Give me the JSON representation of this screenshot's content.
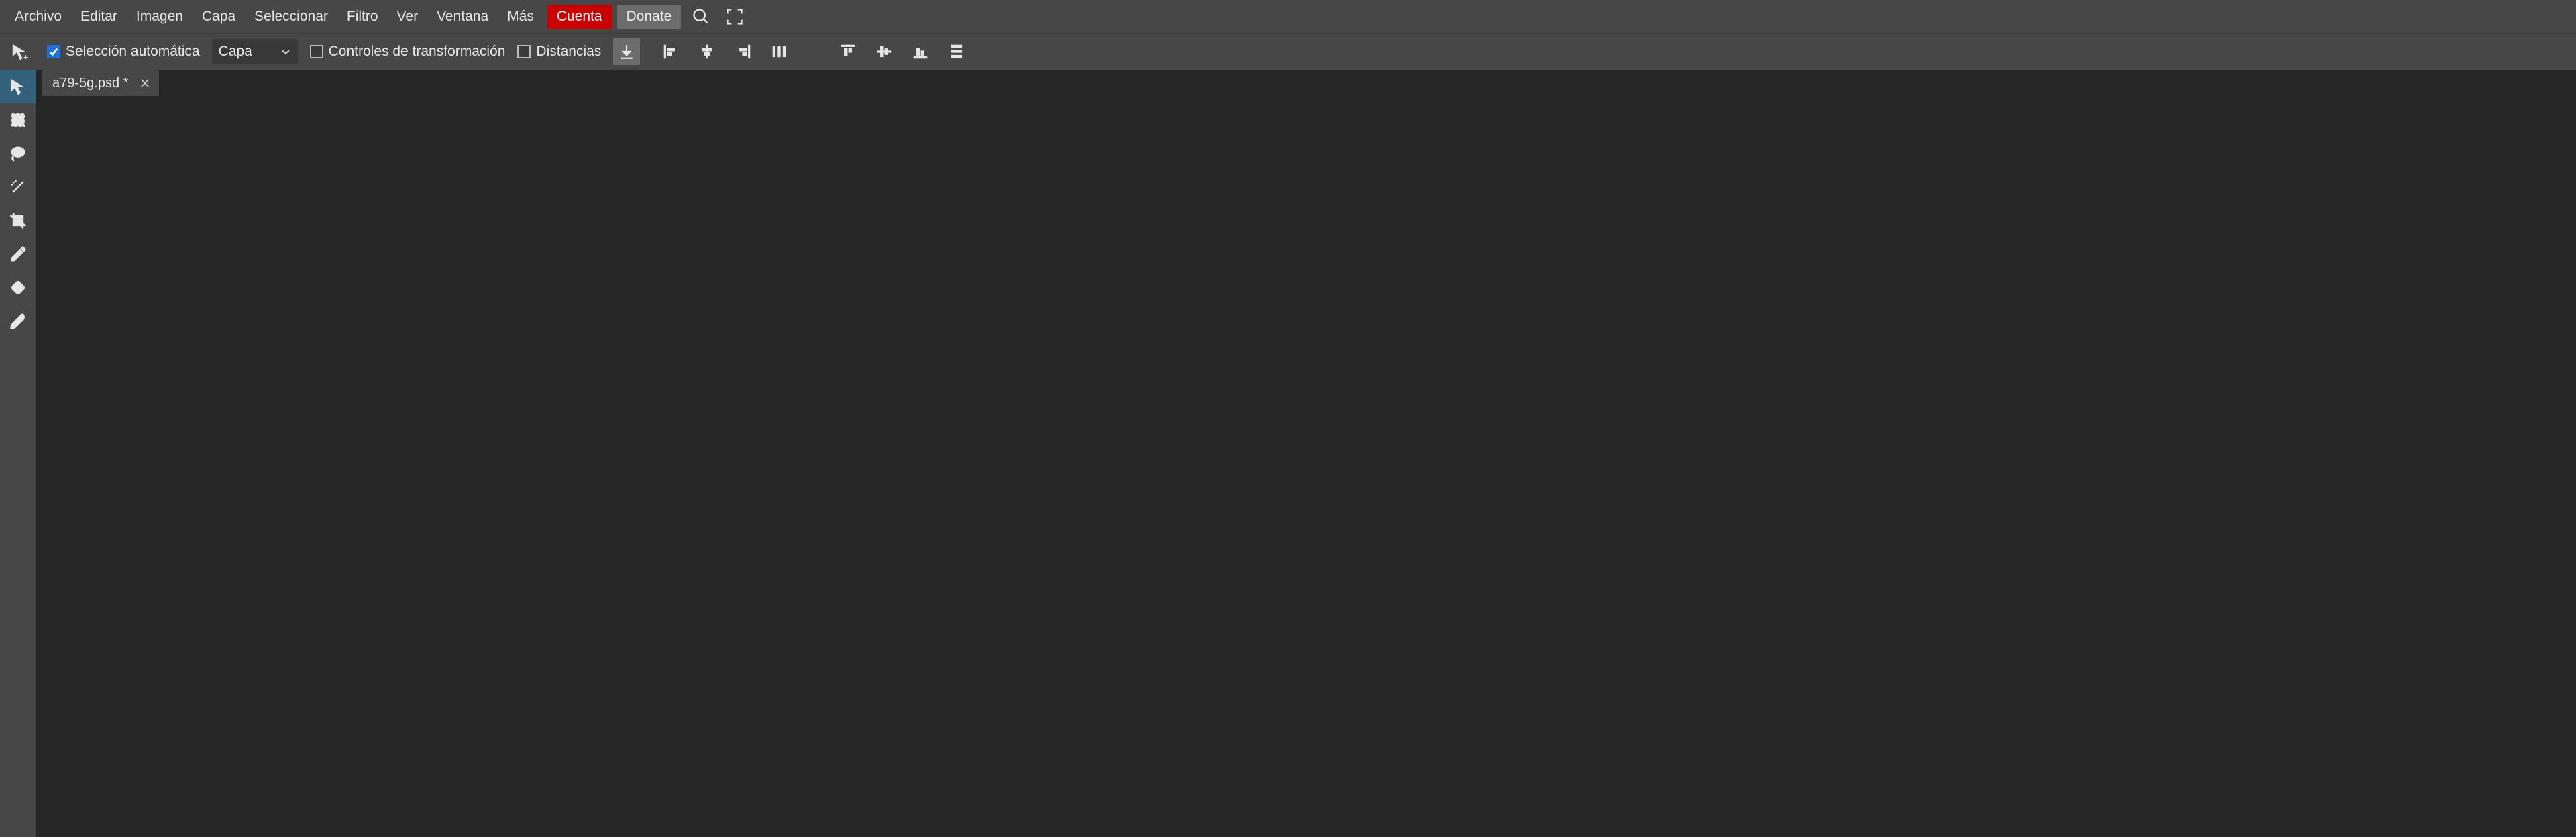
{
  "menu": {
    "items": [
      "Archivo",
      "Editar",
      "Imagen",
      "Capa",
      "Seleccionar",
      "Filtro",
      "Ver",
      "Ventana",
      "Más"
    ],
    "account": "Cuenta",
    "donate": "Donate"
  },
  "options": {
    "auto_select_label": "Selección automática",
    "auto_select_checked": true,
    "layer_dropdown": "Capa",
    "transform_controls_label": "Controles de transformación",
    "transform_controls_checked": false,
    "distances_label": "Distancias",
    "distances_checked": false
  },
  "tabs": {
    "items": [
      {
        "label": "a79-5g.psd *"
      }
    ]
  }
}
